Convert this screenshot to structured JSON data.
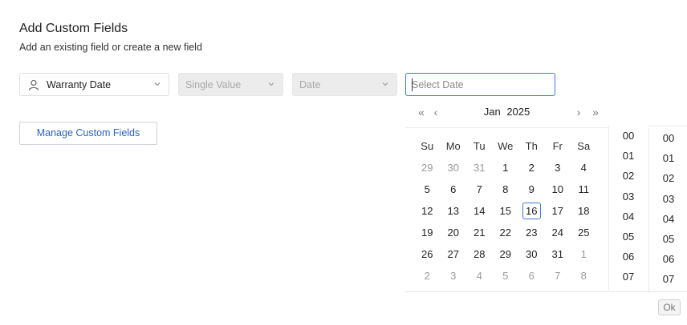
{
  "header": {
    "title": "Add Custom Fields",
    "subtitle": "Add an existing field or create a new field"
  },
  "form": {
    "field_select": {
      "value": "Warranty Date",
      "icon": "user-icon"
    },
    "value_type_select": {
      "value": "Single Value",
      "disabled": true
    },
    "data_type_select": {
      "value": "Date",
      "disabled": true
    },
    "date_input": {
      "placeholder": "Select Date",
      "value": ""
    },
    "manage_button_label": "Manage Custom Fields"
  },
  "datepicker": {
    "month": "Jan",
    "year": "2025",
    "nav": {
      "prev_year": "«",
      "prev_month": "‹",
      "next_month": "›",
      "next_year": "»"
    },
    "weekdays": [
      "Su",
      "Mo",
      "Tu",
      "We",
      "Th",
      "Fr",
      "Sa"
    ],
    "weeks": [
      [
        "29",
        "30",
        "31",
        "1",
        "2",
        "3",
        "4"
      ],
      [
        "5",
        "6",
        "7",
        "8",
        "9",
        "10",
        "11"
      ],
      [
        "12",
        "13",
        "14",
        "15",
        "16",
        "17",
        "18"
      ],
      [
        "19",
        "20",
        "21",
        "22",
        "23",
        "24",
        "25"
      ],
      [
        "26",
        "27",
        "28",
        "29",
        "30",
        "31",
        "1"
      ],
      [
        "2",
        "3",
        "4",
        "5",
        "6",
        "7",
        "8"
      ]
    ],
    "today": "16",
    "hours": [
      "00",
      "01",
      "02",
      "03",
      "04",
      "05",
      "06",
      "07"
    ],
    "minutes": [
      "00",
      "01",
      "02",
      "03",
      "04",
      "05",
      "06",
      "07"
    ],
    "ok_label": "Ok"
  },
  "colors": {
    "accent": "#3c7ad6",
    "link": "#2a63c4",
    "disabled_bg": "#ececec"
  }
}
